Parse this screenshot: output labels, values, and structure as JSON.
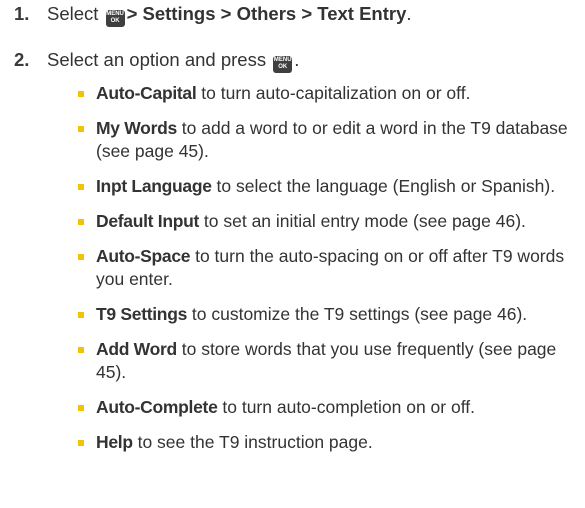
{
  "steps": [
    {
      "number": "1.",
      "prefix": "Select",
      "key_top": "MENU",
      "key_bottom": "OK",
      "path": "> Settings > Others > Text Entry",
      "suffix": "."
    },
    {
      "number": "2.",
      "text": "Select an option and press",
      "key_top": "MENU",
      "key_bottom": "OK",
      "suffix": "."
    }
  ],
  "options": [
    {
      "term": "Auto-Capital",
      "desc": " to turn auto-capitalization on or off."
    },
    {
      "term": "My Words",
      "desc": " to add a word to or edit a word in the T9 database (see page 45)."
    },
    {
      "term": "Inpt Language",
      "desc": " to select the language (English or Spanish)."
    },
    {
      "term": "Default Input",
      "desc": " to set an initial entry mode (see page 46)."
    },
    {
      "term": "Auto-Space",
      "desc": " to turn the auto-spacing on or off after T9 words you enter."
    },
    {
      "term": "T9 Settings",
      "desc": " to customize the T9 settings (see page 46)."
    },
    {
      "term": "Add Word",
      "desc": " to store words that you use frequently (see page 45)."
    },
    {
      "term": "Auto-Complete",
      "desc": " to turn auto-completion on or off."
    },
    {
      "term": "Help",
      "desc": " to see the T9 instruction page."
    }
  ],
  "colors": {
    "bullet": "#f1c400",
    "key": "#3f3f3f",
    "text": "#333333"
  }
}
